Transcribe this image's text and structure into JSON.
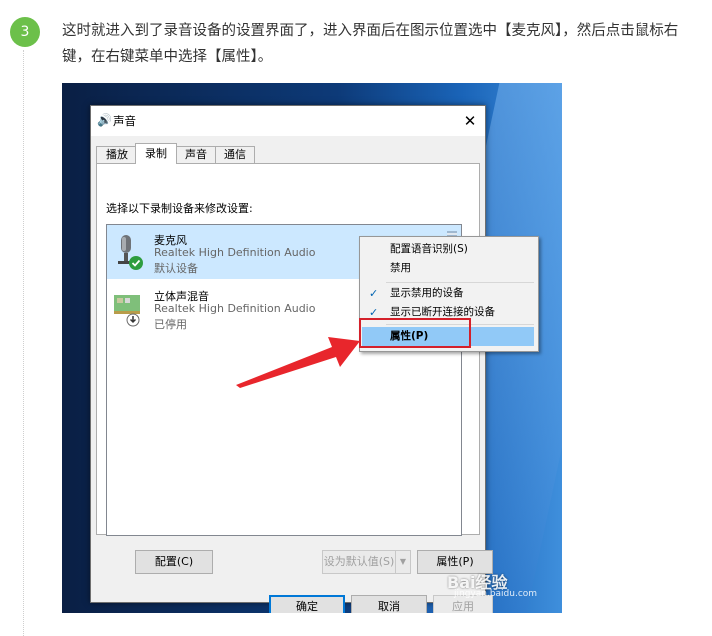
{
  "step": {
    "number": "3",
    "text": "这时就进入到了录音设备的设置界面了，进入界面后在图示位置选中【麦克风】，然后点击鼠标右键，在右键菜单中选择【属性】。"
  },
  "dialog": {
    "title": "声音",
    "close_label": "✕",
    "tabs": [
      {
        "label": "播放"
      },
      {
        "label": "录制"
      },
      {
        "label": "声音"
      },
      {
        "label": "通信"
      }
    ],
    "instruction": "选择以下录制设备来修改设置:",
    "devices": [
      {
        "name": "麦克风",
        "description": "Realtek High Definition Audio",
        "status": "默认设备"
      },
      {
        "name": "立体声混音",
        "description": "Realtek High Definition Audio",
        "status": "已停用"
      }
    ],
    "buttons": {
      "configure": "配置(C)",
      "set_default": "设为默认值(S)",
      "properties": "属性(P)",
      "ok": "确定",
      "cancel": "取消",
      "apply": "应用"
    }
  },
  "context_menu": {
    "items": [
      {
        "label": "配置语音识别(S)",
        "checked": false
      },
      {
        "label": "禁用",
        "checked": false
      },
      {
        "label": "显示禁用的设备",
        "checked": true
      },
      {
        "label": "显示已断开连接的设备",
        "checked": true
      },
      {
        "label": "属性(P)",
        "checked": false,
        "highlighted": true
      }
    ]
  },
  "watermark": {
    "brand": "Bai经验",
    "url": "jingyan.baidu.com"
  },
  "colors": {
    "accent_green": "#6cc04a",
    "selection_blue": "#cce8ff",
    "highlight_red": "#d4202a"
  }
}
